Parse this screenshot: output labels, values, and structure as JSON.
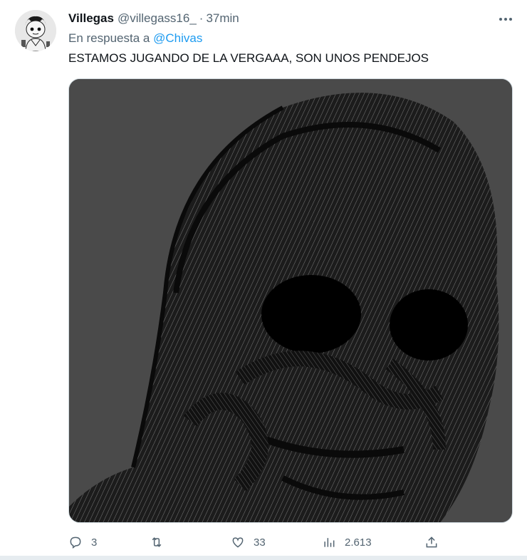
{
  "tweet": {
    "display_name": "Villegas",
    "handle": "@villegass16_",
    "separator": "·",
    "time": "37min",
    "reply_prefix": "En respuesta a",
    "reply_mention": "@Chivas",
    "text": "ESTAMOS JUGANDO DE LA VERGAAA, SON UNOS PENDEJOS",
    "more_icon": "more-horizontal-icon"
  },
  "actions": {
    "replies": "3",
    "retweets": "",
    "likes": "33",
    "views": "2.613"
  },
  "colors": {
    "accent": "#1d9bf0",
    "secondary_text": "#536471",
    "primary_text": "#0f1419"
  }
}
